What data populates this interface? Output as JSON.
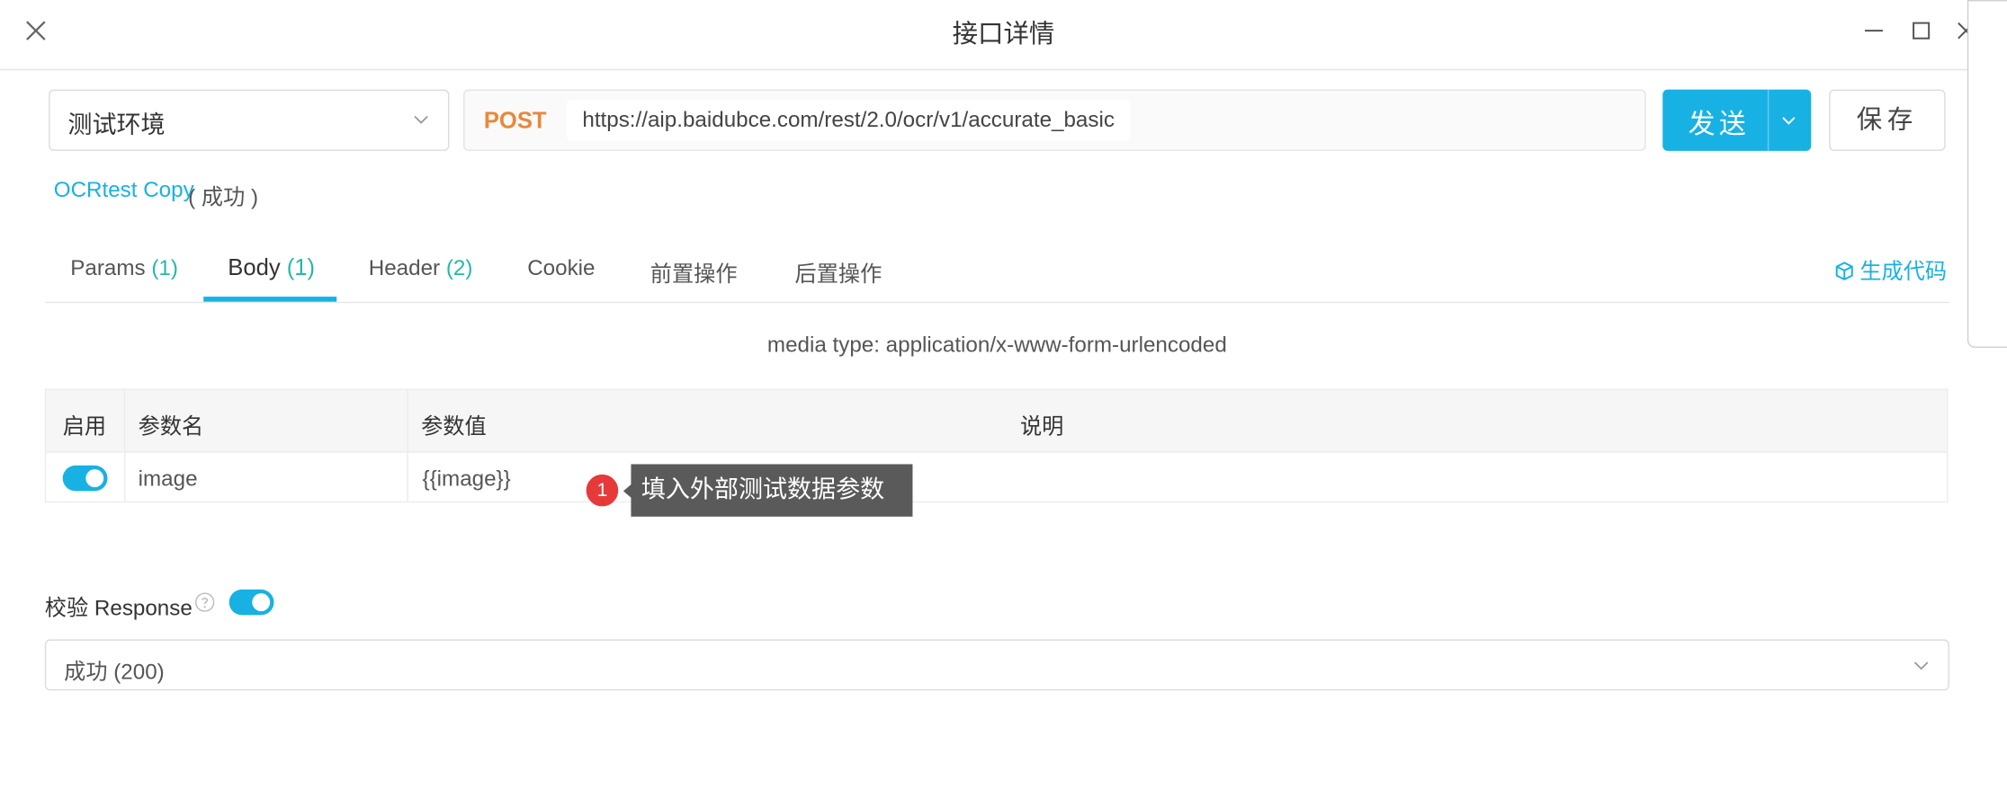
{
  "window": {
    "title": "接口详情"
  },
  "request": {
    "environment": "测试环境",
    "method": "POST",
    "url": "https://aip.baidubce.com/rest/2.0/ocr/v1/accurate_basic",
    "send_label": "发送",
    "save_label": "保存",
    "method_color": "#e8883a",
    "accent_color": "#18b1e3"
  },
  "api": {
    "name": "OCRtest Copy",
    "status": "( 成功 )"
  },
  "tabs": [
    {
      "label": "Params",
      "count": "(1)"
    },
    {
      "label": "Body",
      "count": "(1)",
      "active": true
    },
    {
      "label": "Header",
      "count": "(2)"
    },
    {
      "label": "Cookie"
    },
    {
      "label": "前置操作"
    },
    {
      "label": "后置操作"
    }
  ],
  "gen_code_label": "生成代码",
  "body": {
    "media_type": "media type: application/x-www-form-urlencoded",
    "columns": [
      "启用",
      "参数名",
      "参数值",
      "说明"
    ],
    "rows": [
      {
        "enabled": true,
        "name": "image",
        "value": "{{image}}",
        "description": ""
      }
    ]
  },
  "annotation": {
    "number": "1",
    "text": "填入外部测试数据参数"
  },
  "response": {
    "label": "校验 Response",
    "enabled": true,
    "selected": "成功 (200)"
  }
}
